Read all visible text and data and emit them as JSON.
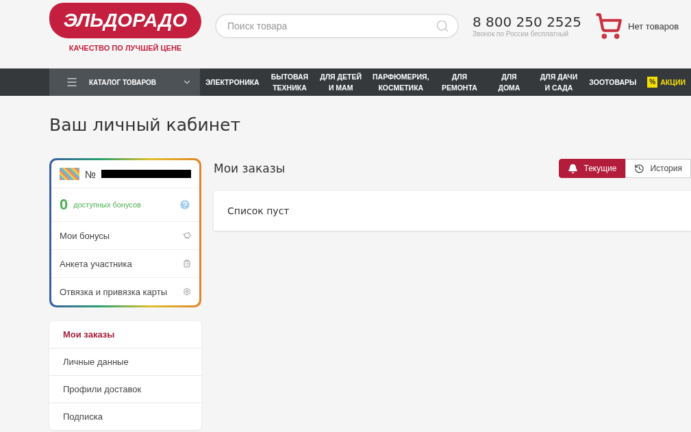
{
  "header": {
    "logo": "ЭЛЬДОРАДО",
    "slogan": "КАЧЕСТВО ПО ЛУЧШЕЙ ЦЕНЕ",
    "search": {
      "placeholder": "Поиск товара"
    },
    "phone": "8 800 250 2525",
    "phone_note": "Звонок по России бесплатный",
    "cart": "Нет товаров"
  },
  "nav": {
    "catalog": "КАТАЛОГ ТОВАРОВ",
    "items": [
      {
        "kind": "plain",
        "lines": [
          "ЭЛЕКТРОНИКА"
        ]
      },
      {
        "kind": "plain",
        "lines": [
          "БЫТОВАЯ",
          "ТЕХНИКА"
        ]
      },
      {
        "kind": "plain",
        "lines": [
          "ДЛЯ ДЕТЕЙ",
          "И МАМ"
        ]
      },
      {
        "kind": "plain",
        "lines": [
          "ПАРФЮМЕРИЯ,",
          "КОСМЕТИКА"
        ]
      },
      {
        "kind": "plain",
        "lines": [
          "ДЛЯ",
          "РЕМОНТА"
        ]
      },
      {
        "kind": "plain",
        "lines": [
          "ДЛЯ",
          "ДОМА"
        ]
      },
      {
        "kind": "plain",
        "lines": [
          "ДЛЯ ДАЧИ",
          "И САДА"
        ]
      },
      {
        "kind": "plain",
        "lines": [
          "ЗООТОВАРЫ"
        ]
      },
      {
        "kind": "promo",
        "badge": "%",
        "lines": [
          "АКЦИИ"
        ]
      }
    ]
  },
  "page_title": "Ваш личный кабинет",
  "card": {
    "number_sign": "№",
    "bonus_count": "0",
    "bonus_label": "доступных бонусов",
    "links": [
      {
        "label": "Мои бонусы",
        "kind": "piggy"
      },
      {
        "label": "Анкета участника",
        "kind": "clipboard"
      },
      {
        "label": "Отвязка и привязка карты",
        "kind": "gear"
      }
    ]
  },
  "menu": [
    {
      "label": "Мои заказы",
      "selected": true
    },
    {
      "label": "Личные данные",
      "selected": false
    },
    {
      "label": "Профили доставок",
      "selected": false
    },
    {
      "label": "Подписка",
      "selected": false
    }
  ],
  "orders": {
    "title": "Мои заказы",
    "tabs": [
      {
        "label": "Текущие",
        "kind": "bell",
        "selected": true
      },
      {
        "label": "История",
        "kind": "history",
        "selected": false
      }
    ],
    "empty": "Список пуст"
  }
}
